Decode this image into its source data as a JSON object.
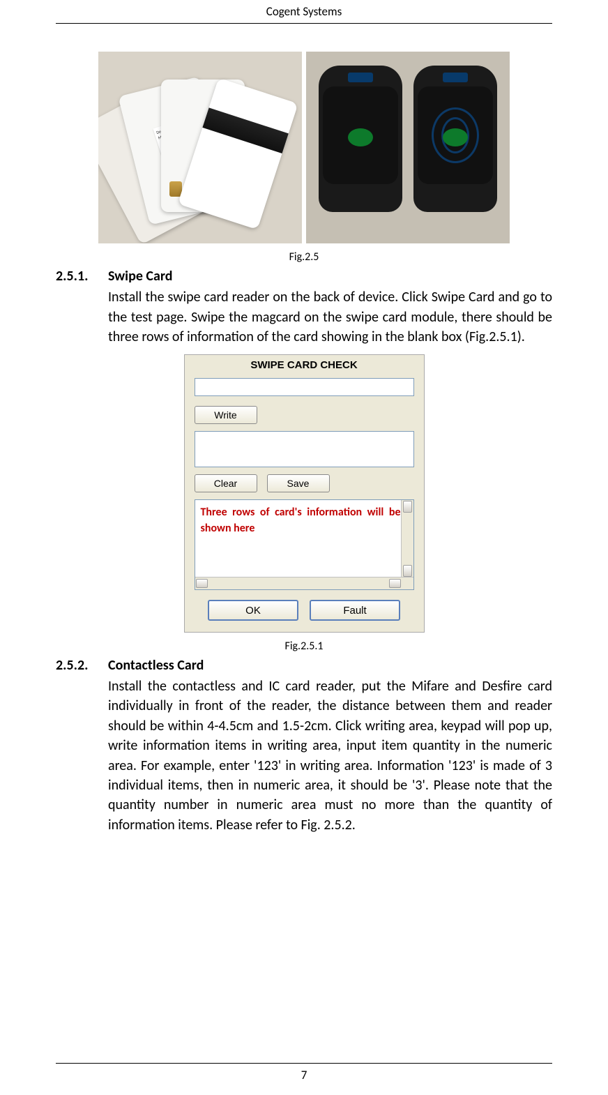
{
  "header": {
    "title": "Cogent Systems"
  },
  "figure1": {
    "caption": "Fig.2.5",
    "card_label_line1": "Desfire Card",
    "card_label_line2": "MF3 IC D40"
  },
  "section1": {
    "number": "2.5.1.",
    "title": "Swipe Card",
    "body": "Install the swipe card reader on the back of device. Click Swipe Card and go to the test page. Swipe the magcard on the swipe card module, there should be three rows of information of the card showing in the blank box (Fig.2.5.1)."
  },
  "dialog": {
    "title": "SWIPE CARD CHECK",
    "write": "Write",
    "clear": "Clear",
    "save": "Save",
    "annotation": "Three rows of card's information will be shown here",
    "ok": "OK",
    "fault": "Fault"
  },
  "figure2": {
    "caption": "Fig.2.5.1"
  },
  "section2": {
    "number": "2.5.2.",
    "title": "Contactless Card",
    "body": "Install the contactless and IC card reader, put the Mifare and Desfire card individually in front of the reader, the distance between them and reader should be within 4-4.5cm and 1.5-2cm. Click writing area, keypad will pop up, write information items in writing area, input item quantity in the numeric area. For example, enter '123' in writing area. Information '123' is made of 3 individual items, then in numeric area, it should be '3'. Please note that the quantity number in numeric area must no more than the quantity of information items. Please refer to Fig. 2.5.2."
  },
  "footer": {
    "page_number": "7"
  }
}
